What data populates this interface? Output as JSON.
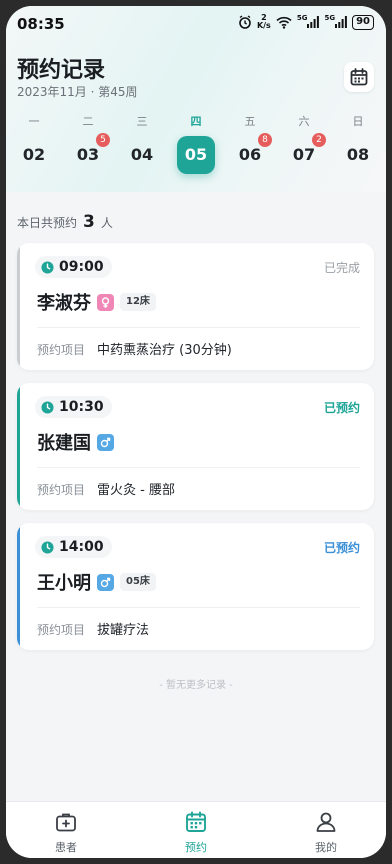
{
  "status_bar": {
    "time": "08:35",
    "net_speed_top": "2",
    "net_speed_unit": "K/s",
    "signal1": "5G",
    "signal2": "5G",
    "battery": "90"
  },
  "header": {
    "title": "预约记录",
    "subtitle": "2023年11月 · 第45周"
  },
  "week": [
    {
      "label": "一",
      "num": "02",
      "badge": "",
      "selected": false
    },
    {
      "label": "二",
      "num": "03",
      "badge": "5",
      "selected": false
    },
    {
      "label": "三",
      "num": "04",
      "badge": "",
      "selected": false
    },
    {
      "label": "四",
      "num": "05",
      "badge": "",
      "selected": true
    },
    {
      "label": "五",
      "num": "06",
      "badge": "8",
      "selected": false
    },
    {
      "label": "六",
      "num": "07",
      "badge": "2",
      "selected": false
    },
    {
      "label": "日",
      "num": "08",
      "badge": "",
      "selected": false
    }
  ],
  "summary": {
    "prefix": "本日共预约",
    "count": "3",
    "suffix": "人"
  },
  "appointments": [
    {
      "time": "09:00",
      "status": "已完成",
      "status_color": "#9aa0a6",
      "accent": "#c9ccd1",
      "name": "李淑芬",
      "gender": "female",
      "bed": "12床",
      "item_label": "预约项目",
      "item": "中药熏蒸治疗 (30分钟)"
    },
    {
      "time": "10:30",
      "status": "已预约",
      "status_color": "#1fa597",
      "accent": "#1fa597",
      "name": "张建国",
      "gender": "male",
      "bed": "",
      "item_label": "预约项目",
      "item": "雷火灸 - 腰部"
    },
    {
      "time": "14:00",
      "status": "已预约",
      "status_color": "#3b8fd6",
      "accent": "#3b8fd6",
      "name": "王小明",
      "gender": "male",
      "bed": "05床",
      "item_label": "预约项目",
      "item": "拔罐疗法"
    }
  ],
  "no_more": "- 暂无更多记录 -",
  "tabs": [
    {
      "label": "患者",
      "icon": "medical-kit-icon",
      "active": false
    },
    {
      "label": "预约",
      "icon": "calendar-icon",
      "active": true
    },
    {
      "label": "我的",
      "icon": "user-icon",
      "active": false
    }
  ],
  "colors": {
    "accent": "#1fa597",
    "badge": "#e65d5d"
  }
}
